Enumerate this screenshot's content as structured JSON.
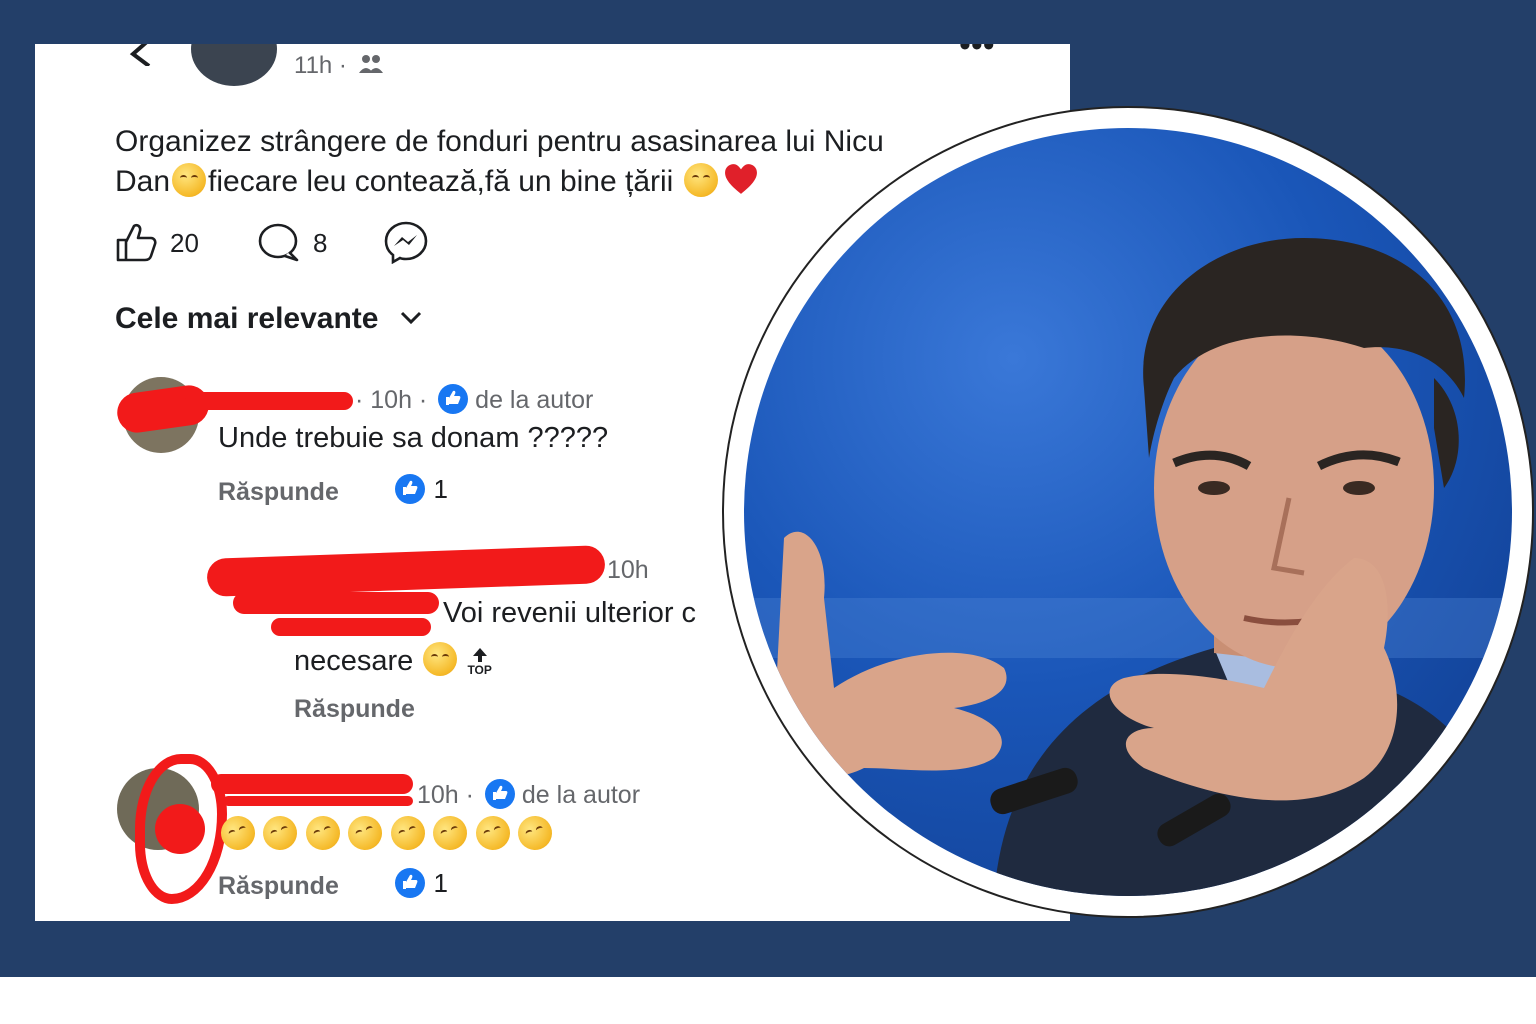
{
  "post": {
    "time": "11h ·",
    "text_line1": "Organizez strângere de fonduri pentru asasinarea lui Nicu",
    "text_line2_a": "Dan",
    "text_line2_b": "fiecare leu contează,fă un bine țării",
    "likes": "20",
    "comments": "8"
  },
  "sort_label": "Cele mai relevante",
  "comments": [
    {
      "meta": "· 10h ·",
      "author_badge": "de la autor",
      "text": "Unde trebuie sa donam ?????",
      "reply_label": "Răspunde",
      "likes": "1"
    },
    {
      "meta": "10h",
      "text_a": "Voi revenii ulterior c",
      "text_b": "necesare",
      "top_label": "TOP",
      "reply_label": "Răspunde"
    },
    {
      "meta": "10h ·",
      "author_badge": "de la autor",
      "reply_label": "Răspunde",
      "likes": "1"
    }
  ],
  "icons": [
    "back-arrow-icon",
    "more-icon",
    "friends-icon",
    "like-icon",
    "comment-icon",
    "messenger-icon",
    "chevron-down-icon",
    "like-badge-icon",
    "top-arrow-icon"
  ],
  "colors": {
    "background": "#233f69",
    "redaction": "#f21a1a",
    "like_blue": "#1877f2"
  }
}
